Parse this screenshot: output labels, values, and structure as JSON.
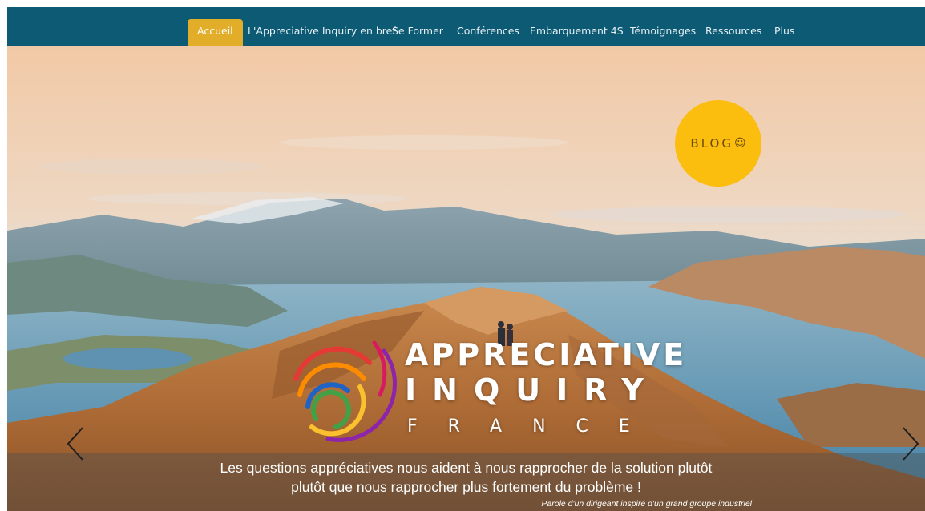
{
  "nav": {
    "items": [
      {
        "label": "Accueil",
        "active": true
      },
      {
        "label": "L'Appreciative Inquiry en bref"
      },
      {
        "label": "Se Former"
      },
      {
        "label": "Conférences"
      },
      {
        "label": "Embarquement 4S"
      },
      {
        "label": "Témoignages"
      },
      {
        "label": "Ressources"
      },
      {
        "label": "Plus"
      }
    ],
    "background_color": "#0d5a74",
    "active_color": "#e2ad28"
  },
  "hero": {
    "blog_badge": {
      "label": "BLOG",
      "smiley": "☺",
      "color": "#fbbd0e"
    },
    "logo": {
      "line1": "APPRECIATIVE",
      "line2": "INQUIRY",
      "line3": "FRANCE",
      "icon": "rainbow-arcs-logo-icon"
    },
    "caption": {
      "line1": "Les questions appréciatives nous aident à nous rapprocher de la solution plutôt",
      "line2": "plutôt que nous rapprocher plus fortement du problème !",
      "source": "Parole d'un dirigeant inspiré d'un grand groupe industriel"
    },
    "controls": {
      "prev_icon": "chevron-left-icon",
      "next_icon": "chevron-right-icon"
    }
  }
}
